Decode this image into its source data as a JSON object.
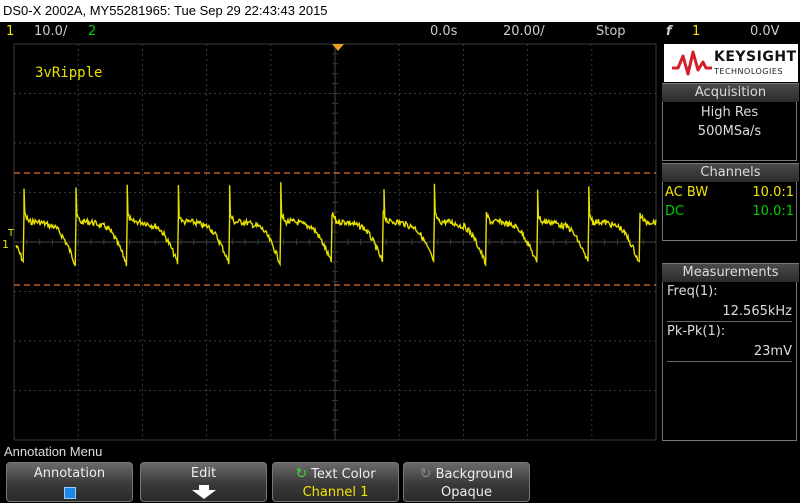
{
  "title_bar": {
    "text": "DS0-X 2002A, MY55281965: Tue Sep 29 22:43:43 2015"
  },
  "status_bar": {
    "ch1_num": "1",
    "ch1_scale": "10.0",
    "ch1_scale_unit": "/",
    "ch2_num": "2",
    "time_delay": "0.0s",
    "timebase": "20.00",
    "timebase_unit": "/",
    "run_state": "Stop",
    "trig_icon": "f",
    "trig_source": "1",
    "trig_level": "0.0V"
  },
  "waveform": {
    "annotation": "3vRipple",
    "ch1_marker": "1",
    "trig_marker": "T",
    "color": "#e6e000",
    "grid_color": "#3a3a3a",
    "cursor_color": "#e07030"
  },
  "brand": {
    "name": "KEYSIGHT",
    "sub": "TECHNOLOGIES",
    "logo_color": "#d0202a"
  },
  "acquisition": {
    "header": "Acquisition",
    "mode": "High Res",
    "rate": "500MSa/s"
  },
  "channels": {
    "header": "Channels",
    "rows": [
      {
        "label": "AC BW",
        "value": "10.0:1",
        "color": "#f2e600"
      },
      {
        "label": "DC",
        "value": "10.0:1",
        "color": "#00d000"
      }
    ]
  },
  "measurements": {
    "header": "Measurements",
    "items": [
      {
        "label": "Freq(1):",
        "value": "12.565kHz"
      },
      {
        "label": "Pk-Pk(1):",
        "value": "23mV"
      }
    ]
  },
  "menu": {
    "title": "Annotation Menu"
  },
  "softkeys": [
    {
      "label": "Annotation",
      "value": ""
    },
    {
      "label": "Edit",
      "value": ""
    },
    {
      "label": "Text Color",
      "value": "Channel 1"
    },
    {
      "label": "Background",
      "value": "Opaque"
    }
  ]
}
